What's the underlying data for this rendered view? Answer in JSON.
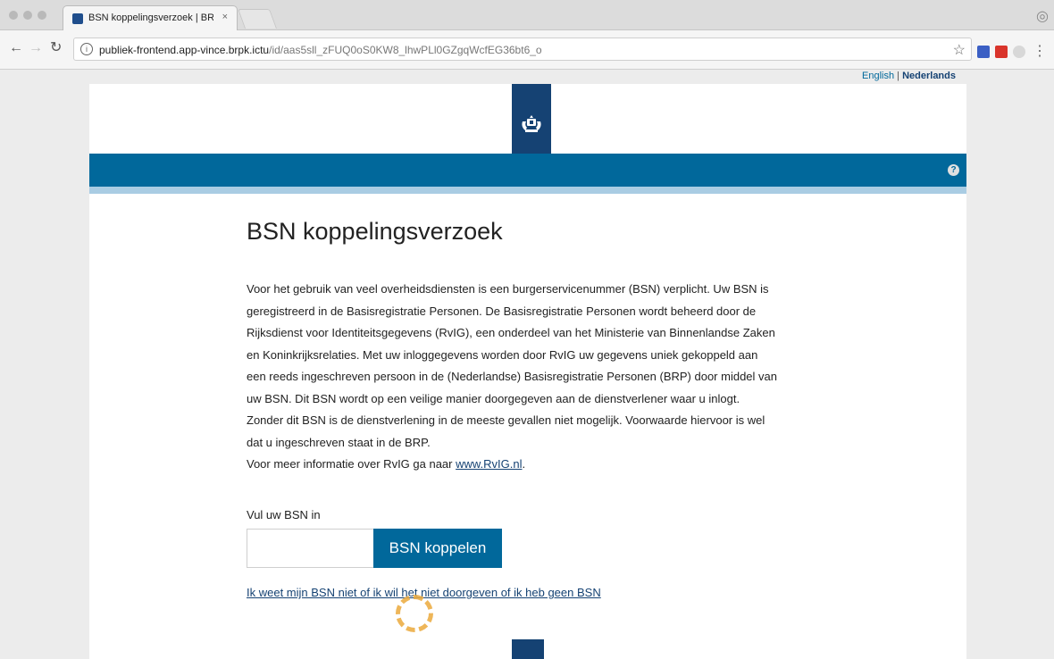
{
  "browser": {
    "tab_title": "BSN koppelingsverzoek | BRP",
    "tab_close": "×",
    "url_host": "publiek-frontend.app-vince.brpk.ictu",
    "url_path": "/id/aas5sll_zFUQ0oS0KW8_lhwPLl0GZgqWcfEG36bt6_o"
  },
  "language": {
    "english": "English",
    "separator": "|",
    "dutch": "Nederlands"
  },
  "page": {
    "title": "BSN koppelingsverzoek",
    "intro_lines": [
      "Voor het gebruik van veel overheidsdiensten is een burgerservicenummer (BSN) verplicht. Uw BSN is",
      "geregistreerd in de Basisregistratie Personen. De Basisregistratie Personen wordt beheerd door de",
      "Rijksdienst voor Identiteitsgegevens (RvIG), een onderdeel van het Ministerie van Binnenlandse Zaken",
      "en Koninkrijksrelaties. Met uw inloggegevens worden door RvIG uw gegevens uniek gekoppeld aan",
      "een reeds ingeschreven persoon in de (Nederlandse) Basisregistratie Personen (BRP) door middel van",
      "uw BSN. Dit BSN wordt op een veilige manier doorgegeven aan de dienstverlener waar u inlogt.",
      "Zonder dit BSN is de dienstverlening in de meeste gevallen niet mogelijk. Voorwaarde hiervoor is wel",
      "dat u ingeschreven staat in de BRP."
    ],
    "more_info_prefix": "Voor meer informatie over RvIG ga naar ",
    "more_info_link": "www.RvIG.nl",
    "more_info_suffix": ".",
    "bsn_label": "Vul uw BSN in",
    "bsn_value": "",
    "bsn_button": "BSN koppelen",
    "no_bsn_link": "Ik weet mijn BSN niet of ik wil het niet doorgeven of ik heb geen BSN",
    "help_icon": "?"
  },
  "icons": {
    "back": "back-arrow-icon",
    "forward": "forward-arrow-icon",
    "reload": "reload-icon",
    "info": "info-icon",
    "bookmark": "star-icon",
    "menu": "kebab-menu-icon"
  },
  "colors": {
    "rijksoverheid_blue": "#154273",
    "bar_blue": "#01689b",
    "light_blue": "#a9cce3"
  }
}
